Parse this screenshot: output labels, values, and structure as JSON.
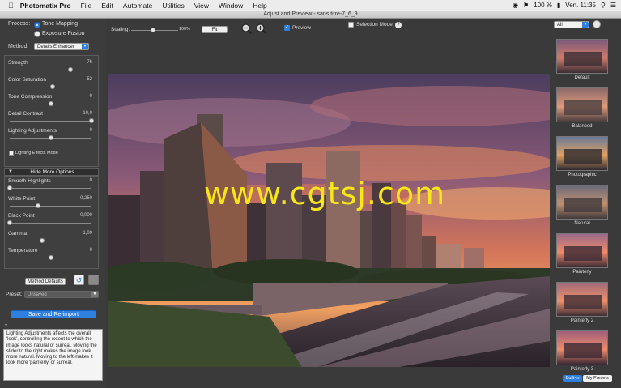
{
  "menubar": {
    "app": "Photomatix Pro",
    "items": [
      "File",
      "Edit",
      "Automate",
      "Utilities",
      "View",
      "Window",
      "Help"
    ],
    "battery": "100 %",
    "clock": "Ven. 11:35"
  },
  "window": {
    "title": "Adjust and Preview - sans titre-7_6_9"
  },
  "toolbar": {
    "scaling_label": "Scaling:",
    "scaling_value": "100%",
    "fit_label": "Fit",
    "preview_label": "Preview",
    "selection_label": "Selection Mode",
    "help": "?",
    "filter_value": "All"
  },
  "process": {
    "label": "Process:",
    "options": [
      "Tone Mapping",
      "Exposure Fusion"
    ],
    "selected": "Tone Mapping"
  },
  "method": {
    "label": "Method:",
    "value": "Details Enhancer"
  },
  "sliders": [
    {
      "label": "Strength",
      "value": "76",
      "pos": 0.74
    },
    {
      "label": "Color Saturation",
      "value": "52",
      "pos": 0.52
    },
    {
      "label": "Tone Compression",
      "value": "0",
      "pos": 0.5
    },
    {
      "label": "Detail Contrast",
      "value": "10,0",
      "pos": 1.0
    },
    {
      "label": "Lighting Adjustments",
      "value": "0",
      "pos": 0.5
    }
  ],
  "lighting_effects_label": "Lighting Effects Mode",
  "hide_more_label": "Hide More Options",
  "more_sliders": [
    {
      "label": "Smooth Highlights",
      "value": "0",
      "pos": 0.0
    },
    {
      "label": "White Point",
      "value": "0,250",
      "pos": 0.35
    },
    {
      "label": "Black Point",
      "value": "0,000",
      "pos": 0.0
    },
    {
      "label": "Gamma",
      "value": "1,00",
      "pos": 0.4
    },
    {
      "label": "Temperature",
      "value": "0",
      "pos": 0.5
    }
  ],
  "method_defaults_label": "Method Defaults",
  "preset": {
    "label": "Preset:",
    "value": "Unsaved"
  },
  "save_button": "Save and Re-import",
  "help_text": "Lighting Adjustments affects the overall 'look', controlling the extent to which the image looks natural or surreal. Moving the slider to the right makes the image look more natural. Moving to the left makes it look more 'painterly' or surreal.",
  "watermark": "www.cgtsj.com",
  "presets": [
    "Default",
    "Balanced",
    "Photographic",
    "Natural",
    "Painterly",
    "Painterly 2",
    "Painterly 3"
  ],
  "preset_tabs": [
    "Built-in",
    "My Presets"
  ],
  "colors": {
    "accent": "#2f7fe0",
    "watermark": "#f6e61a"
  }
}
